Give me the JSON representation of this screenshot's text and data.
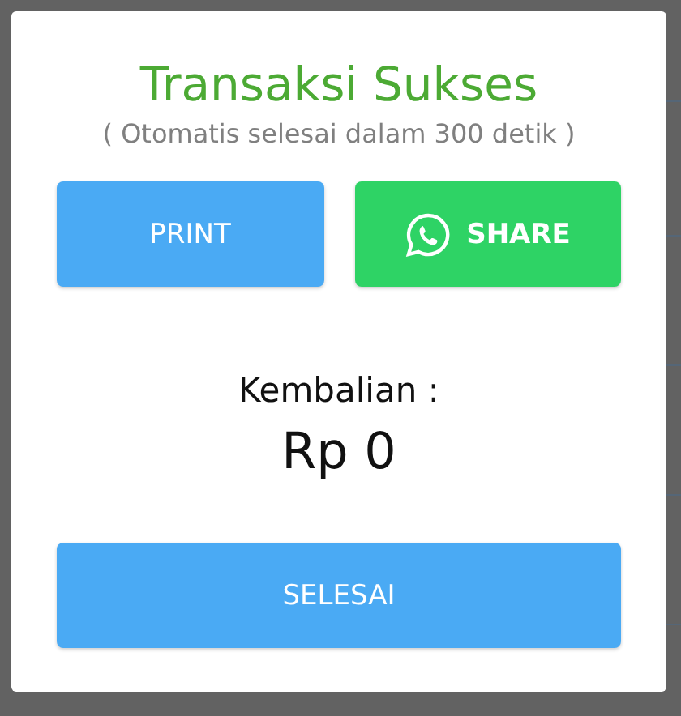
{
  "dialog": {
    "title": "Transaksi Sukses",
    "subtitle": "( Otomatis selesai dalam 300 detik )",
    "buttons": [
      {
        "kind": "print",
        "label": "PRINT"
      },
      {
        "kind": "share",
        "label": "SHARE"
      }
    ],
    "change_label": "Kembalian :",
    "change_amount": "Rp 0",
    "done_button": "SELESAI"
  }
}
